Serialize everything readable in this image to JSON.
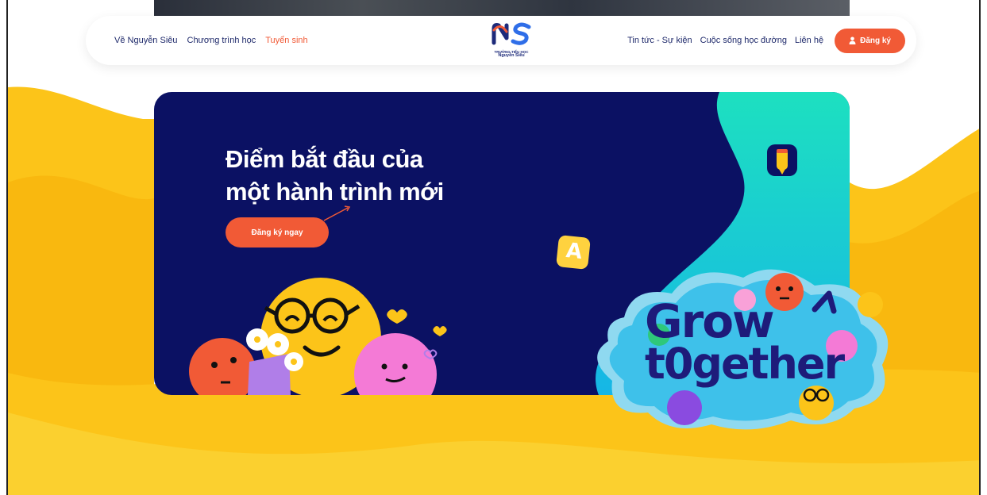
{
  "nav": {
    "left_links": [
      "Về Nguyễn Siêu",
      "Chương trình học",
      "Tuyển sinh"
    ],
    "active_link": "Tuyển sinh",
    "right_links": [
      "Tin tức - Sự kiện",
      "Cuộc sống học đường",
      "Liên hệ"
    ],
    "register_label": "Đăng ký",
    "logo_mark": "NS",
    "logo_caption_line1": "TRƯỜNG TIỂU HỌC",
    "logo_caption_line2": "Nguyễn Siêu"
  },
  "hero": {
    "title_line1": "Điểm bắt đầu của",
    "title_line2": "một hành trình mới",
    "cta_label": "Đăng ký ngay",
    "sticker_line1": "Grow",
    "sticker_line2": "t0gether",
    "badge_letter": "A"
  },
  "colors": {
    "brand_orange": "#f15a36",
    "navy": "#0b1163",
    "yellow": "#fcc419",
    "teal": "#17c7d1"
  }
}
